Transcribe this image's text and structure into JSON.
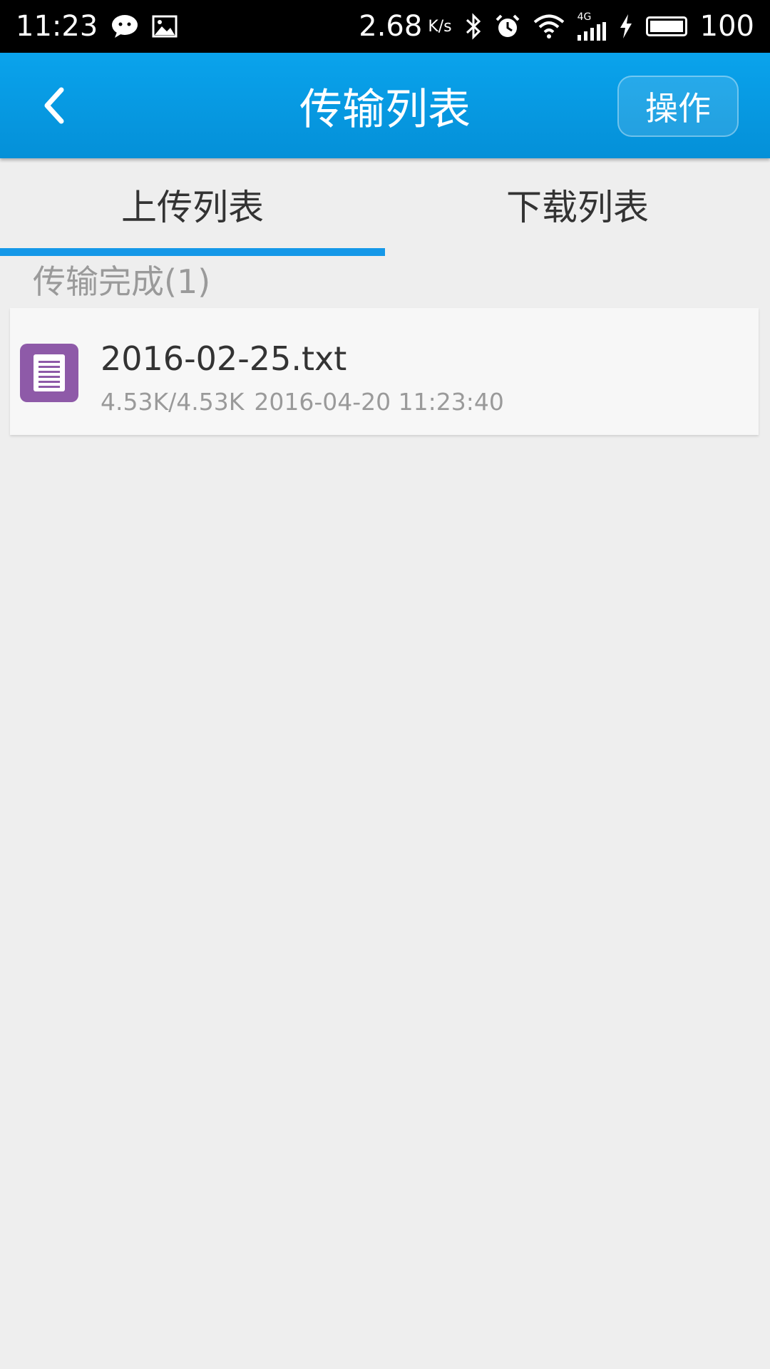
{
  "status_bar": {
    "time": "11:23",
    "net_speed": "2.68",
    "net_speed_unit": "K/s",
    "network_type": "4G",
    "battery": "100",
    "icons": [
      "wechat-icon",
      "image-icon",
      "bluetooth-icon",
      "alarm-icon",
      "wifi-icon",
      "signal-icon",
      "charging-icon",
      "battery-icon"
    ]
  },
  "app_bar": {
    "title": "传输列表",
    "action_label": "操作",
    "back_icon": "chevron-left-icon",
    "color": "#0a9de6"
  },
  "tabs": [
    {
      "label": "上传列表",
      "active": true
    },
    {
      "label": "下载列表",
      "active": false
    }
  ],
  "section": {
    "header": "传输完成(1)"
  },
  "files": [
    {
      "name": "2016-02-25.txt",
      "size": "4.53K/4.53K",
      "timestamp": "2016-04-20 11:23:40",
      "icon": "text-file-icon",
      "icon_color": "#8e5aa8"
    }
  ],
  "colors": {
    "accent": "#1598e8",
    "background": "#eeeeee"
  }
}
